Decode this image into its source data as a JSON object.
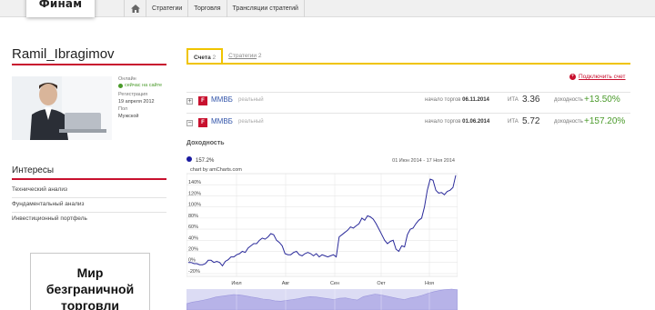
{
  "header": {
    "logo": "Финам",
    "nav": [
      {
        "label": "Стратегии"
      },
      {
        "label": "Торговля"
      },
      {
        "label": "Трансляции стратегий"
      }
    ]
  },
  "profile": {
    "username": "Ramil_Ibragimov",
    "status_label": "Онлайн",
    "status_value": "сейчас на сайте",
    "reg_label": "Регистрация",
    "reg_value": "19 апреля 2012",
    "gender_label": "Пол",
    "gender_value": "Мужской"
  },
  "interests": {
    "title": "Интересы",
    "items": [
      "Технический анализ",
      "Фундаментальный анализ",
      "Инвестиционный портфель"
    ]
  },
  "banner": {
    "line1": "Мир",
    "line2": "безграничной",
    "line3": "торговли"
  },
  "tabs": [
    {
      "label": "Счета",
      "count": "2"
    },
    {
      "label": "Стратегии",
      "count": "2"
    }
  ],
  "connect_label": "Подключить счет",
  "accounts": [
    {
      "toggle": "+",
      "ticker": "ММВБ",
      "kind": "реальный",
      "start_label": "начало торгов",
      "start_date": "06.11.2014",
      "ita_label": "ИТА",
      "ita": "3.36",
      "yield_label": "доходность",
      "yield": "+13.50%"
    },
    {
      "toggle": "−",
      "ticker": "ММВБ",
      "kind": "реальный",
      "start_label": "начало торгов",
      "start_date": "01.06.2014",
      "ita_label": "ИТА",
      "ita": "5.72",
      "yield_label": "доходность",
      "yield": "+157.20%"
    }
  ],
  "yield_section_title": "Доходность",
  "chart_data": {
    "type": "line",
    "legend_value": "157.2%",
    "credit": "chart by amCharts.com",
    "date_range": "01 Июн 2014 - 17 Ноя 2014",
    "x_ticks": [
      "Июл",
      "Авг",
      "Сен",
      "Окт",
      "Ноя"
    ],
    "y_ticks": [
      "-20%",
      "0%",
      "20%",
      "40%",
      "60%",
      "80%",
      "100%",
      "120%",
      "140%"
    ],
    "ylim": [
      -25,
      160
    ],
    "grid": true,
    "line_color": "#2a2a9a",
    "series": [
      {
        "values": [
          0,
          0,
          -2,
          -2,
          -4,
          -4,
          -2,
          4,
          4,
          0,
          2,
          0,
          -6,
          2,
          5,
          10,
          10,
          14,
          16,
          20,
          18,
          26,
          30,
          34,
          34,
          40,
          44,
          42,
          46,
          52,
          50,
          40,
          36,
          30,
          16,
          14,
          14,
          18,
          20,
          14,
          12,
          16,
          18,
          16,
          12,
          16,
          10,
          14,
          12,
          10,
          12,
          14,
          10,
          46,
          50,
          54,
          58,
          64,
          62,
          66,
          70,
          80,
          76,
          84,
          82,
          78,
          70,
          60,
          50,
          40,
          34,
          38,
          40,
          24,
          20,
          30,
          28,
          50,
          60,
          62,
          70,
          76,
          80,
          100,
          130,
          150,
          148,
          130,
          125,
          126,
          122,
          128,
          130,
          135,
          157
        ]
      }
    ],
    "navigator_values": [
      30,
      38,
      42,
      48,
      54,
      62,
      66,
      70,
      74,
      72,
      68,
      62,
      58,
      52,
      50,
      44,
      42,
      46,
      50,
      54,
      60,
      64,
      62,
      58,
      54,
      50,
      56,
      58,
      52,
      48,
      64,
      70,
      76,
      72,
      66,
      60,
      54,
      50,
      58,
      62,
      70,
      80,
      88,
      94,
      98,
      100,
      96
    ]
  }
}
